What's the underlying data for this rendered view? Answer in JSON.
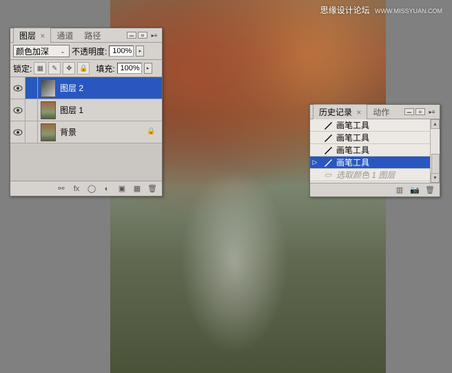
{
  "watermark": {
    "main": "思缘设计论坛",
    "sub": "WWW.MISSYUAN.COM"
  },
  "layers_panel": {
    "tabs": [
      {
        "label": "图层",
        "active": true
      },
      {
        "label": "通道",
        "active": false
      },
      {
        "label": "路径",
        "active": false
      }
    ],
    "blend_mode": "颜色加深",
    "opacity_label": "不透明度:",
    "opacity_value": "100%",
    "lock_label": "锁定:",
    "fill_label": "填充:",
    "fill_value": "100%",
    "layers": [
      {
        "name": "图层 2",
        "visible": true,
        "selected": true,
        "locked": false,
        "thumb_bg": "linear-gradient(135deg,#444 0%,#888 50%,#ccc 100%)"
      },
      {
        "name": "图层 1",
        "visible": true,
        "selected": false,
        "locked": false,
        "thumb_bg": "linear-gradient(to bottom,#a06840 0%,#8a9870 60%,#586040 100%)"
      },
      {
        "name": "背景",
        "visible": true,
        "selected": false,
        "locked": true,
        "thumb_bg": "linear-gradient(to bottom,#a06840 0%,#8a9870 60%,#586040 100%)"
      }
    ]
  },
  "history_panel": {
    "tabs": [
      {
        "label": "历史记录",
        "active": true
      },
      {
        "label": "动作",
        "active": false
      }
    ],
    "items": [
      {
        "label": "画笔工具",
        "icon": "brush",
        "selected": false,
        "future": false,
        "marker": false
      },
      {
        "label": "画笔工具",
        "icon": "brush",
        "selected": false,
        "future": false,
        "marker": false
      },
      {
        "label": "画笔工具",
        "icon": "brush",
        "selected": false,
        "future": false,
        "marker": false
      },
      {
        "label": "画笔工具",
        "icon": "brush",
        "selected": true,
        "future": false,
        "marker": true
      },
      {
        "label": "选取颜色 1 图层",
        "icon": "rect",
        "selected": false,
        "future": true,
        "marker": false
      }
    ]
  }
}
